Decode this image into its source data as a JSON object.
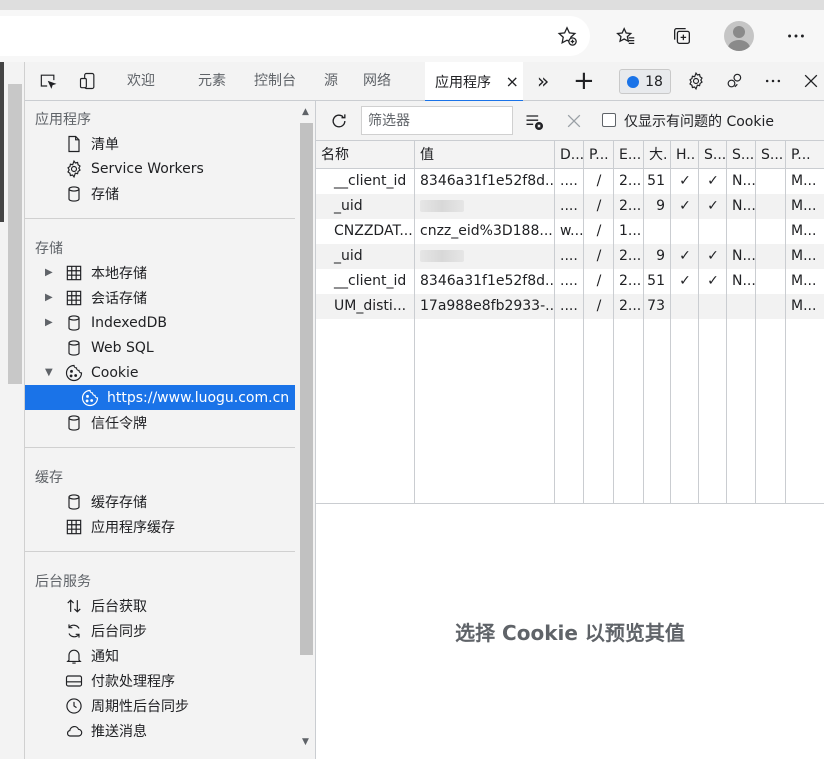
{
  "browser": {
    "icons": [
      "add-favorite-icon",
      "favorites-icon",
      "collections-icon",
      "profile-avatar",
      "more-icon"
    ]
  },
  "devtools": {
    "tabs": [
      "欢迎",
      "元素",
      "控制台",
      "源",
      "网络",
      "应用程序"
    ],
    "active_tab": "应用程序",
    "close_glyph": "×",
    "more_tabs_glyph": "»",
    "add_tab_glyph": "+",
    "issues_count": "18",
    "accent": "#1a73e8"
  },
  "sidebar": {
    "sections": [
      {
        "heading": "应用程序",
        "items": [
          {
            "label": "清单",
            "icon": "document-icon"
          },
          {
            "label": "Service Workers",
            "icon": "gear-icon"
          },
          {
            "label": "存储",
            "icon": "database-icon"
          }
        ]
      },
      {
        "heading": "存储",
        "items": [
          {
            "label": "本地存储",
            "icon": "grid-icon",
            "expandable": true
          },
          {
            "label": "会话存储",
            "icon": "grid-icon",
            "expandable": true
          },
          {
            "label": "IndexedDB",
            "icon": "database-icon",
            "expandable": true
          },
          {
            "label": "Web SQL",
            "icon": "database-icon"
          },
          {
            "label": "Cookie",
            "icon": "cookie-icon",
            "expanded": true
          },
          {
            "label": "https://www.luogu.com.cn",
            "icon": "cookie-icon",
            "selected": true
          },
          {
            "label": "信任令牌",
            "icon": "database-icon"
          }
        ]
      },
      {
        "heading": "缓存",
        "items": [
          {
            "label": "缓存存储",
            "icon": "database-icon"
          },
          {
            "label": "应用程序缓存",
            "icon": "grid-icon"
          }
        ]
      },
      {
        "heading": "后台服务",
        "items": [
          {
            "label": "后台获取",
            "icon": "arrows-updown-icon"
          },
          {
            "label": "后台同步",
            "icon": "sync-icon"
          },
          {
            "label": "通知",
            "icon": "bell-icon"
          },
          {
            "label": "付款处理程序",
            "icon": "card-icon"
          },
          {
            "label": "周期性后台同步",
            "icon": "clock-icon"
          },
          {
            "label": "推送消息",
            "icon": "cloud-icon"
          }
        ]
      }
    ]
  },
  "toolbar": {
    "filter_placeholder": "筛选器",
    "only_issues_label": "仅显示有问题的 Cookie"
  },
  "table": {
    "columns": [
      "名称",
      "值",
      "D...",
      "P...",
      "E...",
      "大.",
      "H..",
      "S...",
      "S...",
      "S...",
      "P..."
    ],
    "rows": [
      [
        "__client_id",
        "8346a31f1e52f8d...",
        "....",
        "/",
        "2...",
        "51",
        "✓",
        "✓",
        "N...",
        "",
        "M..."
      ],
      [
        "_uid",
        "",
        "....",
        "/",
        "2...",
        "9",
        "✓",
        "✓",
        "N...",
        "",
        "M..."
      ],
      [
        "CNZZDAT...",
        "cnzz_eid%3D188...",
        "w...",
        "/",
        "1...",
        "",
        "",
        "",
        "",
        "",
        "M..."
      ],
      [
        "_uid",
        "",
        "....",
        "/",
        "2...",
        "9",
        "✓",
        "✓",
        "N...",
        "",
        "M..."
      ],
      [
        "__client_id",
        "8346a31f1e52f8d...",
        "....",
        "/",
        "2...",
        "51",
        "✓",
        "✓",
        "N...",
        "",
        "M..."
      ],
      [
        "UM_disti...",
        "17a988e8fb2933-...",
        "....",
        "/",
        "2...",
        "73",
        "",
        "",
        "",
        "",
        "M..."
      ]
    ],
    "redacted_value_rows": [
      1,
      3
    ]
  },
  "preview": {
    "message": "选择 Cookie 以预览其值"
  }
}
